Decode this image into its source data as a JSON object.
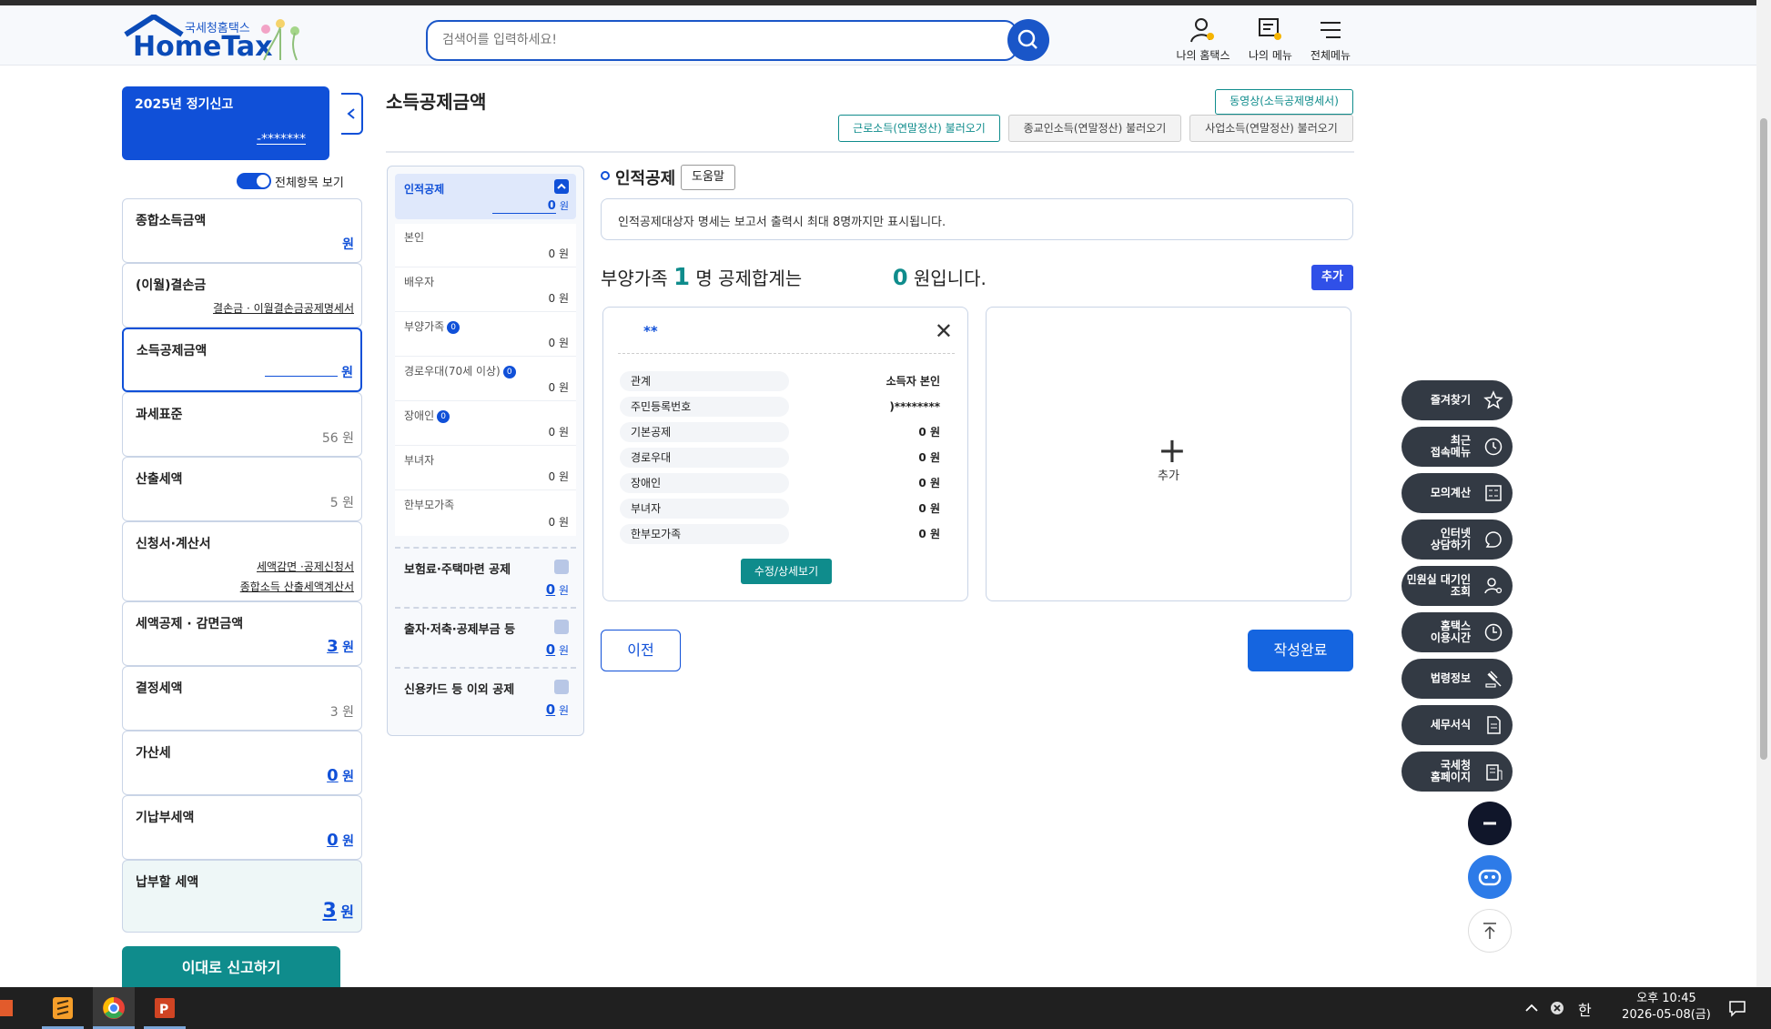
{
  "header": {
    "logo_sub": "국세청홈택스",
    "logo_main": "HomeTax",
    "search_placeholder": "검색어를 입력하세요!",
    "menu": [
      {
        "label": "나의 홈택스",
        "icon": "user-bell-icon"
      },
      {
        "label": "나의 메뉴",
        "icon": "menu-user-icon"
      },
      {
        "label": "전체메뉴",
        "icon": "hamburger-icon"
      }
    ]
  },
  "sidebar": {
    "card_title": "2025년 정기신고",
    "card_masked": "-*******",
    "toggle_label": "전체항목 보기",
    "items": [
      {
        "label": "종합소득금액",
        "value": "",
        "won": "원"
      },
      {
        "label": "(이월)결손금",
        "link": "결손금 · 이월결손금공제명세서"
      },
      {
        "label": "소득공제금액",
        "value": "",
        "won": "원"
      },
      {
        "label": "과세표준",
        "value": "56",
        "won": "원"
      },
      {
        "label": "산출세액",
        "value": "5",
        "won": "원"
      },
      {
        "label": "신청서·계산서",
        "link1": "세액감면 ·공제신청서",
        "link2": "종합소득 산출세액계산서"
      },
      {
        "label": "세액공제 · 감면금액",
        "value": "3",
        "won": "원"
      },
      {
        "label": "결정세액",
        "value": "3",
        "won": "원"
      },
      {
        "label": "가산세",
        "value": "0",
        "won": "원"
      },
      {
        "label": "기납부세액",
        "value": "0",
        "won": "원"
      },
      {
        "label": "납부할 세액",
        "value": "3",
        "won": "원"
      }
    ],
    "report_button": "이대로 신고하기"
  },
  "main": {
    "title": "소득공제금액",
    "video_button": "동영상(소득공제명세서)",
    "load_buttons": [
      "근로소득(연말정산) 불러오기",
      "종교인소득(연말정산) 불러오기",
      "사업소득(연말정산) 불러오기"
    ],
    "panel": {
      "head_label": "인적공제",
      "head_value": "0",
      "won": "원",
      "rows": [
        {
          "label": "본인",
          "value": "0",
          "badge": ""
        },
        {
          "label": "배우자",
          "value": "0",
          "badge": ""
        },
        {
          "label": "부양가족",
          "value": "0",
          "badge": "0"
        },
        {
          "label": "경로우대(70세 이상)",
          "value": "0",
          "badge": "0"
        },
        {
          "label": "장애인",
          "value": "0",
          "badge": "0"
        },
        {
          "label": "부녀자",
          "value": "0",
          "badge": ""
        },
        {
          "label": "한부모가족",
          "value": "0",
          "badge": ""
        }
      ],
      "sections": [
        {
          "label": "보험료·주택마련 공제",
          "value": "0"
        },
        {
          "label": "출자·저축·공제부금 등",
          "value": "0"
        },
        {
          "label": "신용카드 등 이외 공제",
          "value": "0"
        }
      ]
    },
    "section_title": "인적공제",
    "help_button": "도움말",
    "notice": "인적공제대상자 명세는 보고서 출력시 최대 8명까지만 표시됩니다.",
    "summary_prefix": "부양가족",
    "summary_count": "1",
    "summary_mid": "명 공제합계는",
    "summary_amount": "0",
    "summary_suffix": "원입니다.",
    "add_button": "추가",
    "person": {
      "name": "**",
      "rows": [
        {
          "key": "관계",
          "value": "소득자 본인"
        },
        {
          "key": "주민등록번호",
          "value": ")********"
        },
        {
          "key": "기본공제",
          "value": "0  원"
        },
        {
          "key": "경로우대",
          "value": "0  원"
        },
        {
          "key": "장애인",
          "value": "0  원"
        },
        {
          "key": "부녀자",
          "value": "0  원"
        },
        {
          "key": "한부모가족",
          "value": "0  원"
        }
      ],
      "detail_button": "수정/상세보기"
    },
    "add_card_label": "추가",
    "prev_button": "이전",
    "done_button": "작성완료"
  },
  "quick_menu": [
    {
      "label": "즐겨찾기",
      "icon": "star-icon"
    },
    {
      "label": "최근\n접속메뉴",
      "icon": "clock-icon"
    },
    {
      "label": "모의계산",
      "icon": "calculator-icon"
    },
    {
      "label": "인터넷\n상담하기",
      "icon": "chat-icon"
    },
    {
      "label": "민원실 대기인\n조회",
      "icon": "person-search-icon"
    },
    {
      "label": "홈택스\n이용시간",
      "icon": "time-icon"
    },
    {
      "label": "법령정보",
      "icon": "gavel-icon"
    },
    {
      "label": "세무서식",
      "icon": "document-icon"
    },
    {
      "label": "국세청\n홈페이지",
      "icon": "building-icon"
    }
  ],
  "taskbar": {
    "time": "오후 10:45",
    "date": "2026-05-08(금)",
    "ime": "한"
  },
  "colors": {
    "primary": "#1050d8",
    "teal": "#0f8c8c",
    "dark": "#333a44"
  }
}
